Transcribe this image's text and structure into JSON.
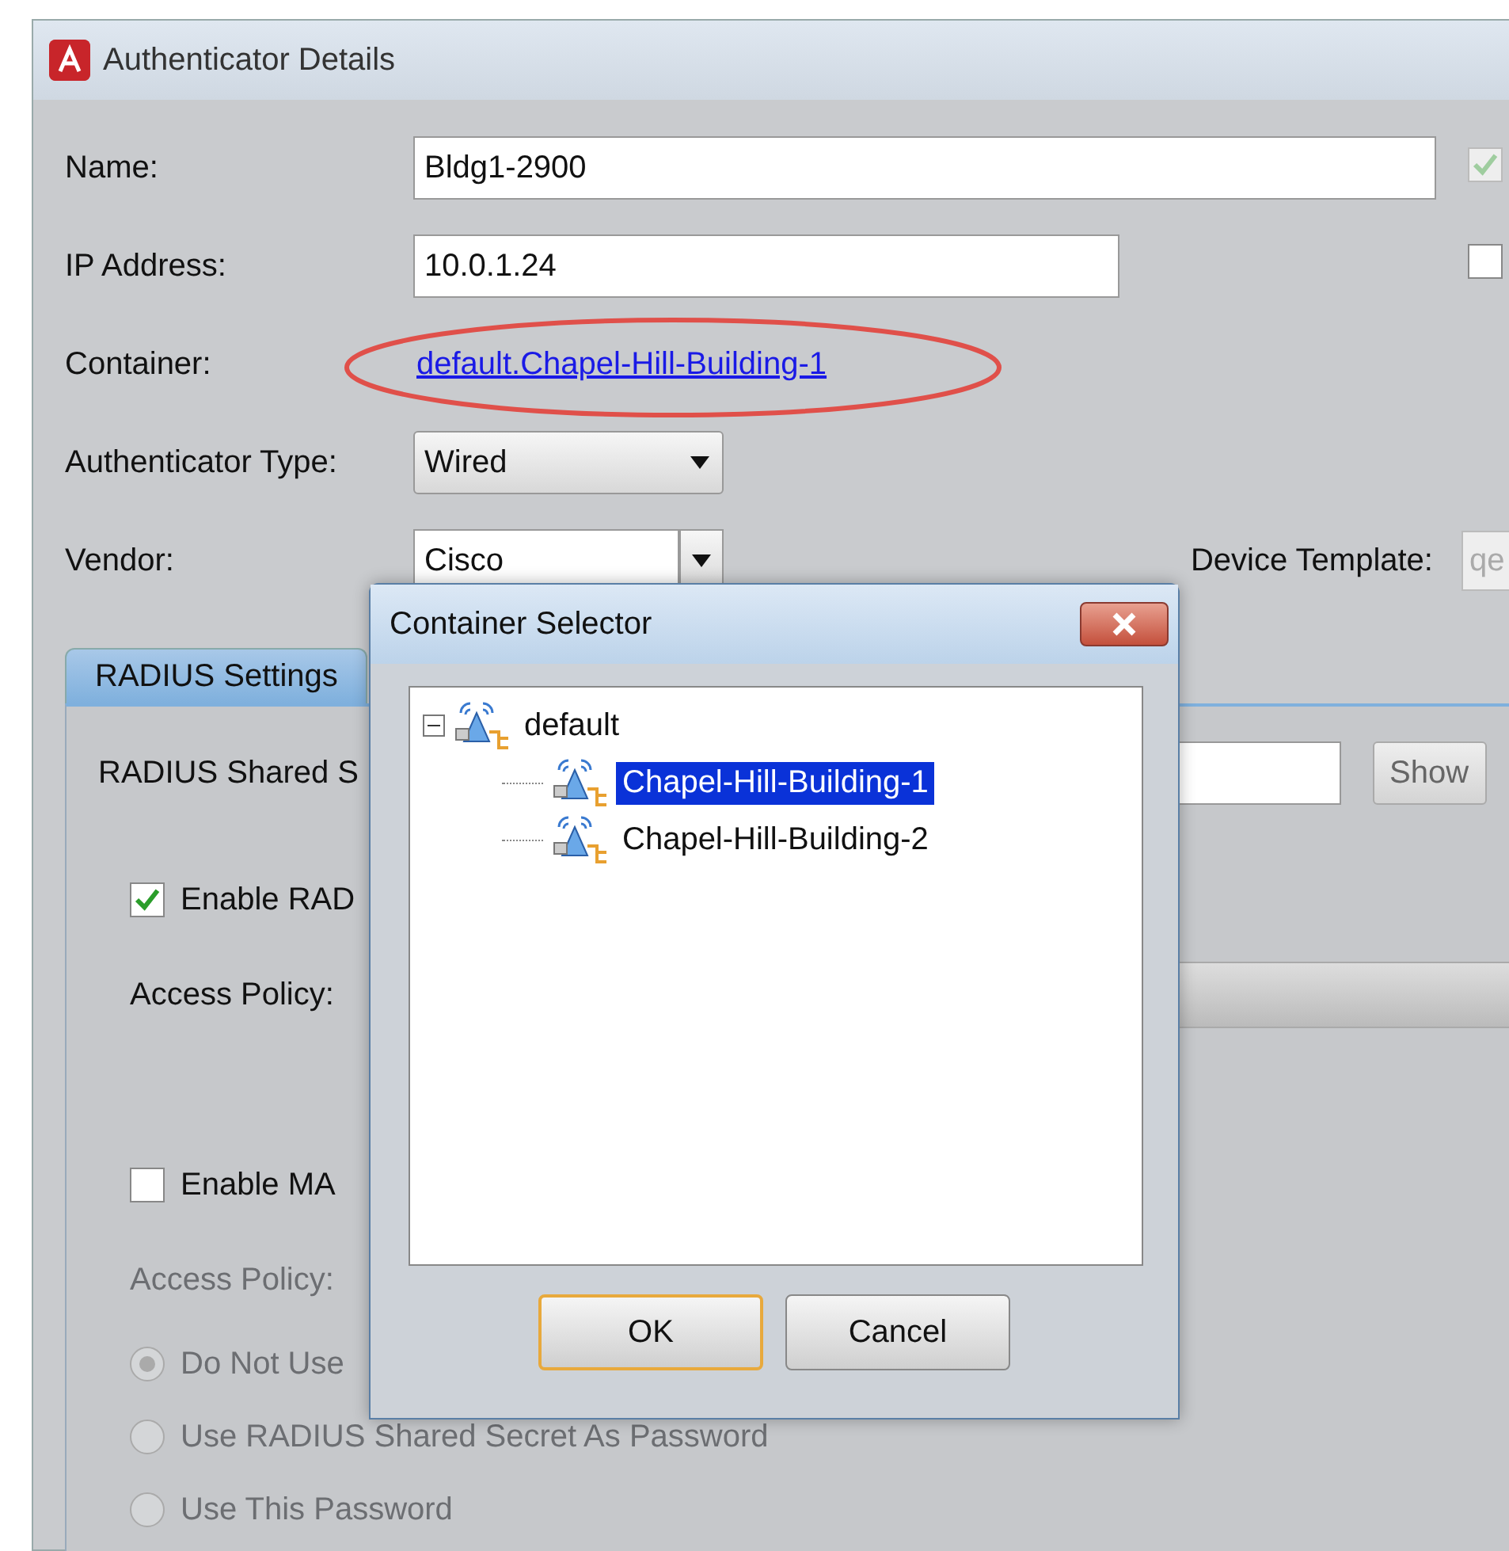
{
  "window": {
    "title": "Authenticator Details"
  },
  "form": {
    "name": {
      "label": "Name:",
      "value": "Bldg1-2900"
    },
    "ip": {
      "label": "IP Address:",
      "value": "10.0.1.24"
    },
    "container": {
      "label": "Container:",
      "link": "default.Chapel-Hill-Building-1"
    },
    "type": {
      "label": "Authenticator Type:",
      "value": "Wired"
    },
    "vendor": {
      "label": "Vendor:",
      "value": "Cisco"
    },
    "device_template": {
      "label": "Device Template:",
      "value": "qe"
    }
  },
  "side_checks": [
    {
      "checked": true,
      "disabled": true
    },
    {
      "checked": false,
      "disabled": false
    }
  ],
  "tabs": [
    {
      "label": "RADIUS Settings",
      "selected": true
    }
  ],
  "radius": {
    "secret_label": "RADIUS Shared S",
    "show_button": "Show",
    "enable_radius": {
      "label": "Enable RAD",
      "checked": true,
      "disabled": false
    },
    "access_policy": {
      "label": "Access Policy:",
      "disabled": false
    },
    "enable_mac": {
      "label": "Enable MA",
      "checked": false,
      "disabled": false
    },
    "mac_access_policy": {
      "label": "Access Policy:",
      "disabled": true
    },
    "password_options": [
      {
        "label": "Do Not Use",
        "selected": true,
        "disabled": true
      },
      {
        "label": "Use RADIUS Shared Secret As Password",
        "selected": false,
        "disabled": true
      },
      {
        "label": "Use This Password",
        "selected": false,
        "disabled": true
      }
    ]
  },
  "dialog": {
    "title": "Container Selector",
    "tree": [
      {
        "label": "default",
        "expanded": true,
        "selected": false,
        "children": [
          {
            "label": "Chapel-Hill-Building-1",
            "selected": true
          },
          {
            "label": "Chapel-Hill-Building-2",
            "selected": false
          }
        ]
      }
    ],
    "buttons": [
      {
        "label": "OK",
        "kind": "default"
      },
      {
        "label": "Cancel",
        "kind": "normal"
      }
    ]
  }
}
